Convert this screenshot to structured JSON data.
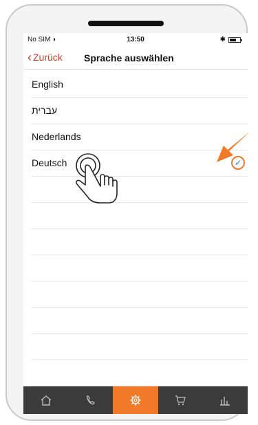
{
  "status": {
    "carrier": "No SIM",
    "time": "13:50"
  },
  "nav": {
    "back_label": "Zurück",
    "title": "Sprache auswählen"
  },
  "languages": [
    {
      "label": "English",
      "selected": false
    },
    {
      "label": "עברית",
      "selected": false
    },
    {
      "label": "Nederlands",
      "selected": false
    },
    {
      "label": "Deutsch",
      "selected": true
    }
  ],
  "tabbar": {
    "active_color": "#f07a2a",
    "tabs": [
      {
        "icon": "home-icon"
      },
      {
        "icon": "phone-icon"
      },
      {
        "icon": "gear-icon",
        "active": true
      },
      {
        "icon": "cart-icon"
      },
      {
        "icon": "chart-icon"
      }
    ]
  },
  "check_symbol": "✓"
}
